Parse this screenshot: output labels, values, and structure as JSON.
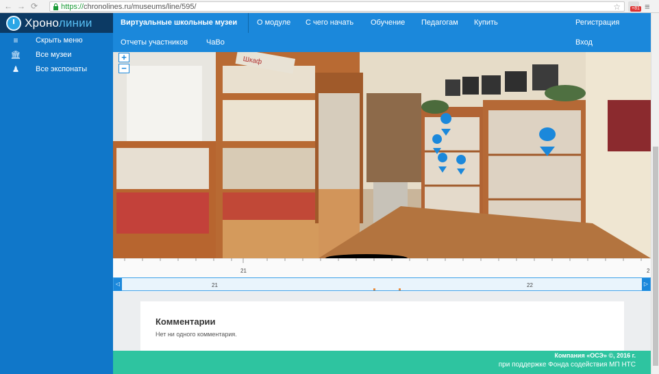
{
  "browser": {
    "back": "←",
    "forward": "→",
    "reload": "⟳",
    "url_https": "https://",
    "url_rest": "chronolines.ru/museums/line/595/",
    "star": "☆",
    "menu": "≡",
    "ext_badge": "+81"
  },
  "logo": {
    "prefix": "Хроно",
    "accent": "линии"
  },
  "sidebar": {
    "items": [
      {
        "icon": "≡",
        "label": "Скрыть меню"
      },
      {
        "icon": "🏛",
        "label": "Все музеи"
      },
      {
        "icon": "♟",
        "label": "Все экспонаты"
      }
    ]
  },
  "topnav": {
    "current": "Виртуальные школьные музеи",
    "links": [
      "О модуле",
      "С чего начать",
      "Обучение",
      "Педагогам",
      "Купить"
    ],
    "row2": [
      "Отчеты участников",
      "ЧаВо"
    ],
    "register": "Регистрация",
    "login": "Вход"
  },
  "panorama": {
    "zoom_in": "+",
    "zoom_out": "−",
    "sign_text": "Шкаф",
    "marker_color": "#1b88db"
  },
  "timeline": {
    "ruler_labels": [
      "21",
      "2"
    ],
    "track_labels": [
      "21",
      "22"
    ],
    "left_arrow": "◁",
    "right_arrow": "▷"
  },
  "comments": {
    "title": "Комментарии",
    "empty_text": "Нет ни одного комментария."
  },
  "footer": {
    "copyright": "Компания «ОСЭ» ©, 2016 г.",
    "support": "при поддержке Фонда содействия МП НТС"
  }
}
